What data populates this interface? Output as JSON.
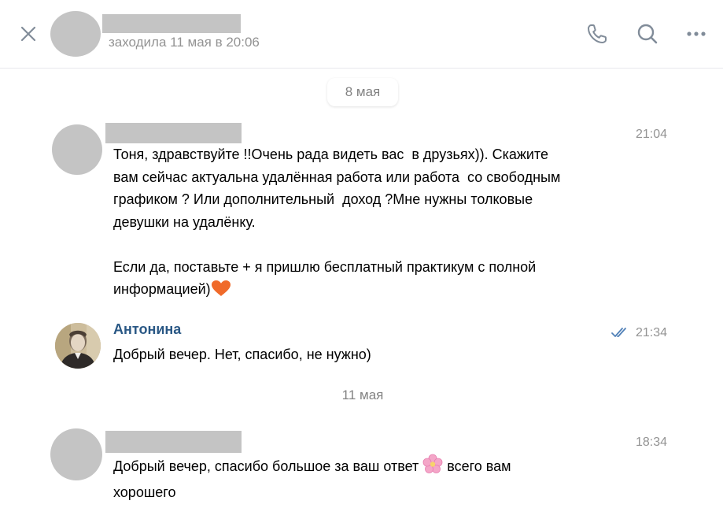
{
  "header": {
    "status": "заходила 11 мая в 20:06",
    "icons": [
      "close-icon",
      "phone-icon",
      "search-icon",
      "more-icon"
    ]
  },
  "dates": {
    "first": "8 мая",
    "second": "11 мая"
  },
  "messages": [
    {
      "time": "21:04",
      "text": "Тоня, здравствуйте !!Очень рада видеть вас  в друзьях)). Скажите\nвам сейчас актуальна удалённая работа или работа  со свободным\nграфиком ? Или дополнительный  доход ?Мне нужны толковые\nдевушки на удалёнку.\n\nЕсли да, поставьте + я пришлю бесплатный практикум с полной\nинформацией)",
      "emoji": "orange-heart-icon"
    },
    {
      "author": "Антонина",
      "time": "21:34",
      "text": "Добрый вечер. Нет, спасибо, не нужно)",
      "status_icon": "double-check-icon"
    },
    {
      "time": "18:34",
      "text_part1": "Добрый вечер, спасибо большое за ваш ответ ",
      "emoji": "cherry-blossom-icon",
      "text_part2": " всего вам\nхорошего"
    }
  ],
  "colors": {
    "accent": "#2a5885",
    "muted": "#939393",
    "icon": "#818c99",
    "redacted": "#c4c4c4"
  }
}
